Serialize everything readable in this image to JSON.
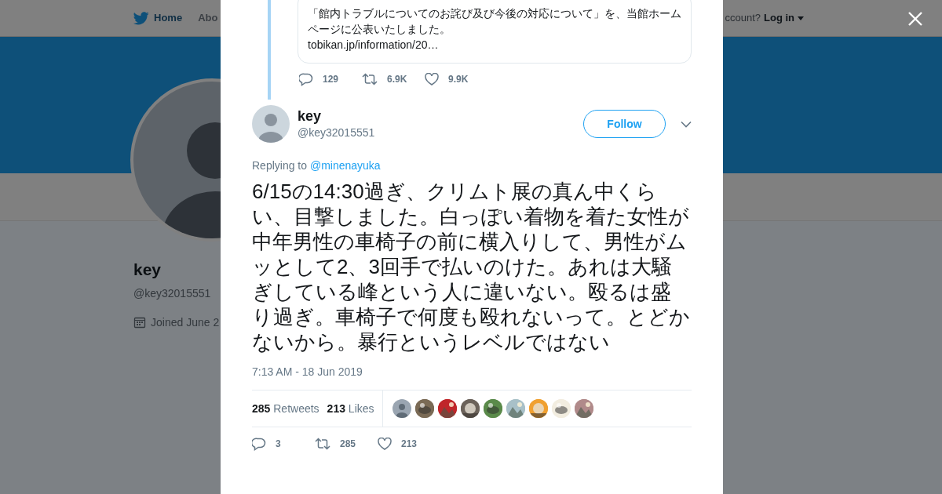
{
  "nav": {
    "items": [
      {
        "label": "Home",
        "selected": true
      },
      {
        "label": "Abo",
        "selected": false
      }
    ],
    "account_prompt": "ccount?",
    "login": "Log in"
  },
  "profile": {
    "name": "key",
    "handle": "@key32015551",
    "joined": "Joined June 2"
  },
  "modal": {
    "quoted_tweet": {
      "text": "「館内トラブルについてのお詫び及び今後の対応について」を、当館ホームページに公表いたしました。",
      "link": "tobikan.jp/information/20…",
      "replies": "129",
      "retweets": "6.9K",
      "likes": "9.9K"
    },
    "tweet": {
      "name": "key",
      "handle": "@key32015551",
      "follow": "Follow",
      "replying_to": "Replying to",
      "mention": "@minenayuka",
      "text": "6/15の14:30過ぎ、クリムト展の真ん中くらい、目撃しました。白っぽい着物を着た女性が中年男性の車椅子の前に横入りして、男性がムッとして2、3回手で払いのけた。あれは大騒ぎしている峰という人に違いない。殴るは盛り過ぎ。車椅子で何度も殴れないって。とどかないから。暴行というレベルではない",
      "time": "7:13 AM - 18 Jun 2019",
      "retweet_count": "285",
      "retweet_label": "Retweets",
      "like_count": "213",
      "like_label": "Likes",
      "likers": [
        {
          "kind": "default",
          "color": "#9aa5b1"
        },
        {
          "kind": "picture",
          "color": "#7a6a55"
        },
        {
          "kind": "picture",
          "color": "#c0262a"
        },
        {
          "kind": "picture",
          "color": "#6b625a"
        },
        {
          "kind": "picture",
          "color": "#5a8a4a"
        },
        {
          "kind": "picture",
          "color": "#a8c0c8"
        },
        {
          "kind": "picture",
          "color": "#f0a030"
        },
        {
          "kind": "picture",
          "color": "#f2ede0"
        },
        {
          "kind": "picture",
          "color": "#b08a8a"
        }
      ],
      "replies": "3",
      "retweets": "285",
      "likes": "213"
    }
  }
}
